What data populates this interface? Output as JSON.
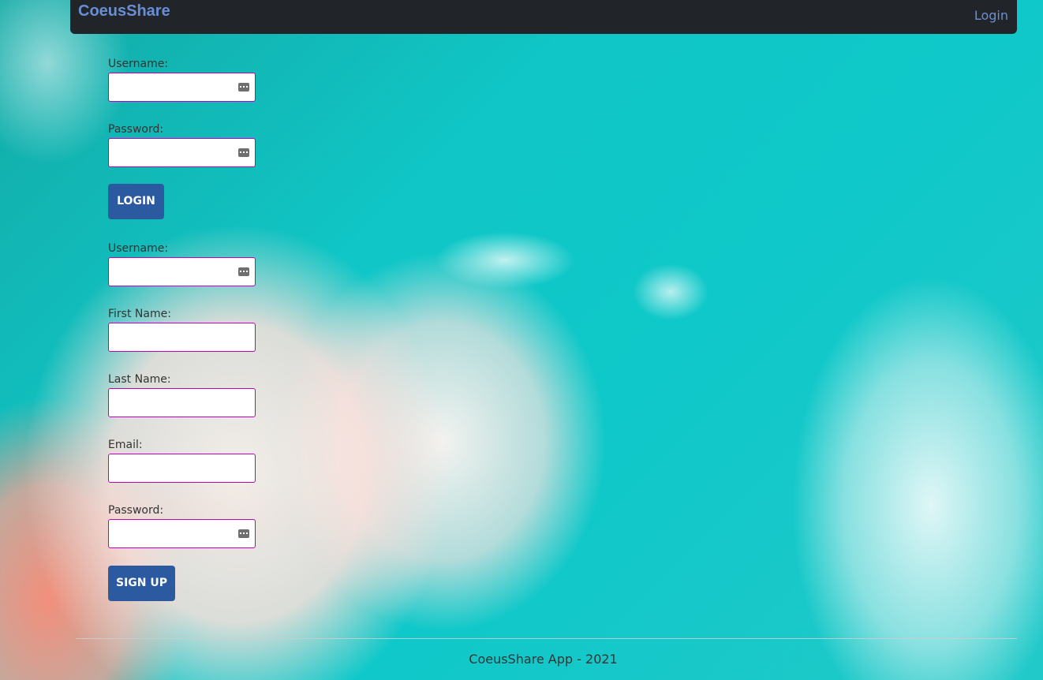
{
  "navbar": {
    "brand": "CoeusShare",
    "login_link": "Login"
  },
  "login_form": {
    "username_label": "Username:",
    "username_value": "",
    "password_label": "Password:",
    "password_value": "",
    "submit_label": "LOGIN"
  },
  "signup_form": {
    "username_label": "Username:",
    "username_value": "",
    "first_name_label": "First Name:",
    "first_name_value": "",
    "last_name_label": "Last Name:",
    "last_name_value": "",
    "email_label": "Email:",
    "email_value": "",
    "password_label": "Password:",
    "password_value": "",
    "submit_label": "SIGN UP"
  },
  "footer": {
    "text": "CoeusShare App - 2021"
  },
  "colors": {
    "navbar_bg": "#212529",
    "brand": "#6a8ed4",
    "button_bg": "#2c5aa0",
    "input_border": "#c000c0"
  },
  "icons": {
    "autofill": "password-manager-key-icon"
  }
}
